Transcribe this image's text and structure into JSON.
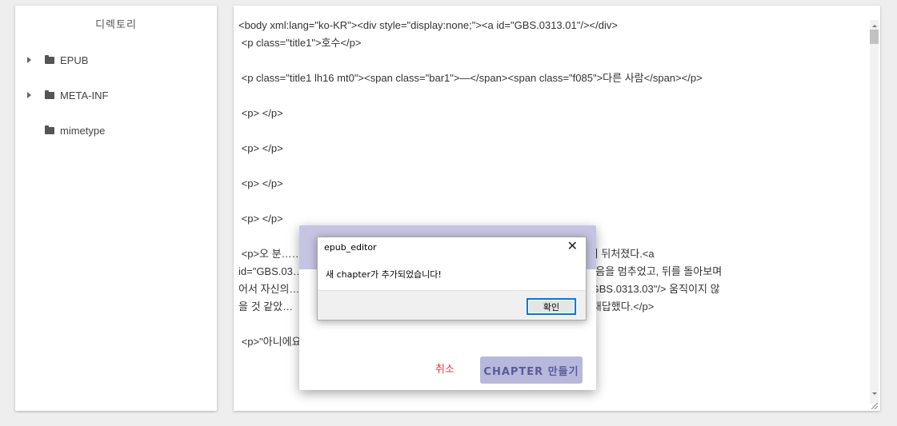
{
  "sidebar": {
    "title": "디렉토리",
    "items": [
      {
        "label": "EPUB",
        "expandable": true
      },
      {
        "label": "META-INF",
        "expandable": true
      },
      {
        "label": "mimetype",
        "expandable": false
      }
    ]
  },
  "editor": {
    "lines": [
      "<body xml:lang=\"ko-KR\"><div style=\"display:none;\"><a id=\"GBS.0313.01\"/></div>",
      " <p class=\"title1\">호수</p>",
      "",
      " <p class=\"title1 lh16 mt0\"><span class=\"bar1\">—</span><span class=\"f085\">다른 사람</span></p>",
      "",
      " <p> </p>",
      "",
      " <p> </p>",
      "",
      " <p> </p>",
      "",
      " <p> </p>",
      "",
      " <p>오 분……                                                                          키지 않으니 걸음이 뒤처졌다.<a",
      "id=\"GBS.03…                                                                          다. 하지만 그는 걸음을 멈추었고, 뒤를 돌아보며",
      "어서 자신의…                                                                        전에는 절대<a id=\"GBS.0313.03\"/> 움직이지 않",
      "을 것 같았…                                                                          가 부드러운 말투로 대답했다.</p>",
      "",
      " <p>\"아니에요, 진영씨. 같이 걸어요.\"</p>"
    ]
  },
  "dialog": {
    "cancel_label": "취소",
    "create_label": "CHAPTER 만들기"
  },
  "alert": {
    "title": "epub_editor",
    "close_symbol": "✕",
    "message": "새 chapter가 추가되었습니다!",
    "ok_label": "확인"
  }
}
